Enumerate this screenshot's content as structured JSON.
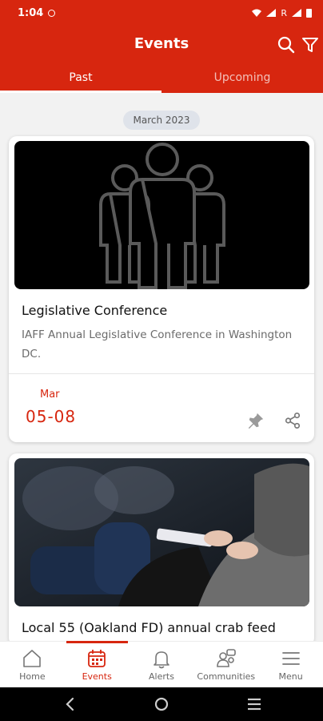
{
  "status_bar": {
    "time": "1:04",
    "carrier_tag": "R"
  },
  "header": {
    "title": "Events",
    "search_icon": "search-icon",
    "filter_icon": "filter-icon"
  },
  "tabs": [
    {
      "label": "Past",
      "active": true
    },
    {
      "label": "Upcoming",
      "active": false
    }
  ],
  "month_header": "March 2023",
  "events": [
    {
      "image": "people-group-placeholder",
      "title": "Legislative Conference",
      "description": "IAFF Annual Legislative Conference in Washington DC.",
      "month": "Mar",
      "date_range": "05-08"
    },
    {
      "image": "conference-attendees-photo",
      "title": "Local 55 (Oakland FD) annual crab feed"
    }
  ],
  "bottom_nav": [
    {
      "label": "Home",
      "icon": "home-icon",
      "active": false
    },
    {
      "label": "Events",
      "icon": "calendar-icon",
      "active": true
    },
    {
      "label": "Alerts",
      "icon": "bell-icon",
      "active": false
    },
    {
      "label": "Communities",
      "icon": "communities-icon",
      "active": false
    },
    {
      "label": "Menu",
      "icon": "menu-icon",
      "active": false
    }
  ],
  "colors": {
    "accent": "#d7260f",
    "background": "#f2f2f2",
    "chip": "#dfe3ea"
  }
}
